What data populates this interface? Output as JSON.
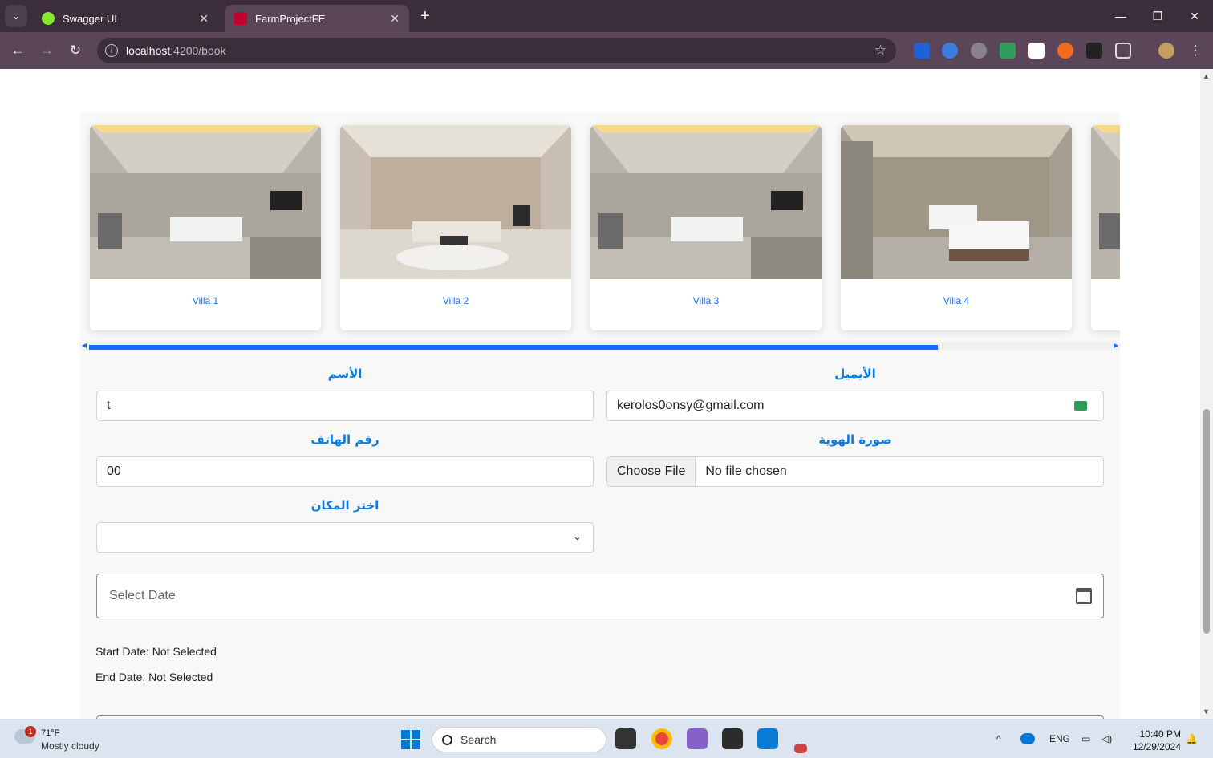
{
  "browser": {
    "tabs": [
      {
        "label": "Swagger UI",
        "icon": "swagger-icon",
        "color": "#85ea2d"
      },
      {
        "label": "FarmProjectFE",
        "icon": "angular-icon",
        "color": "#c3002f"
      }
    ],
    "url_host": "localhost",
    "url_path": ":4200/book"
  },
  "carousel": {
    "cards": [
      {
        "label": "Villa 1"
      },
      {
        "label": "Villa 2"
      },
      {
        "label": "Villa 3"
      },
      {
        "label": "Villa 4"
      }
    ],
    "scroll_progress": 0.82
  },
  "form": {
    "name_label": "الأسم",
    "name_value": "t",
    "email_label": "الأيميل",
    "email_value": "kerolos0onsy@gmail.com",
    "phone_label": "رقم الهاتف",
    "phone_value": "00",
    "id_photo_label": "صورة الهوية",
    "choose_file": "Choose File",
    "file_status": "No file chosen",
    "place_label": "اختر المكان",
    "place_value": "",
    "date_placeholder": "Select Date",
    "start_date": "Start Date: Not Selected",
    "end_date": "End Date: Not Selected",
    "accent_color": "#0d7be0"
  },
  "taskbar": {
    "weather_temp": "71°F",
    "weather_desc": "Mostly cloudy",
    "weather_badge": "1",
    "search_placeholder": "Search",
    "language": "ENG",
    "time": "10:40 PM",
    "date": "12/29/2024"
  }
}
